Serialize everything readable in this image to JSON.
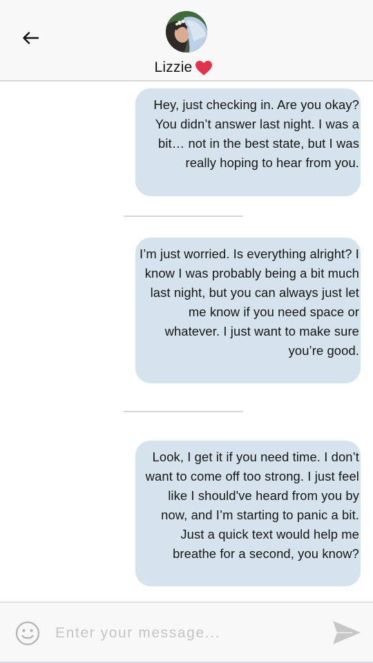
{
  "header": {
    "back_icon": "arrow-left-icon",
    "contact_name": "Lizzie",
    "heart_icon": "heart-icon",
    "heart_color": "#e0334f"
  },
  "messages": [
    {
      "text": "Hey, just checking in. Are you okay? You didn’t answer last night. I was a bit… not in the best state, but I was really hoping to hear from you."
    },
    {
      "text": "I’m just worried. Is everything alright? I know I was probably being a bit much last night, but you can always just let me know if you need space or whatever. I just want to make sure you’re good."
    },
    {
      "text": "Look, I get it if you need time. I don’t want to come off too strong. I just feel like I should've heard from you by now, and I’m starting to panic a bit. Just a quick text would help me breathe for a second, you know?"
    }
  ],
  "composer": {
    "emoji_icon": "smiley-icon",
    "placeholder": "Enter your message...",
    "value": "",
    "send_icon": "send-icon"
  },
  "colors": {
    "bubble": "#d5e3ec",
    "header_bg": "#f8f8f8",
    "divider": "#d6d6d6"
  }
}
